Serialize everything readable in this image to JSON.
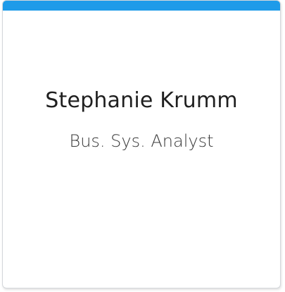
{
  "card": {
    "accent_color": "#1e9be9",
    "name": "Stephanie Krumm",
    "job_title": "Bus. Sys. Analyst"
  }
}
